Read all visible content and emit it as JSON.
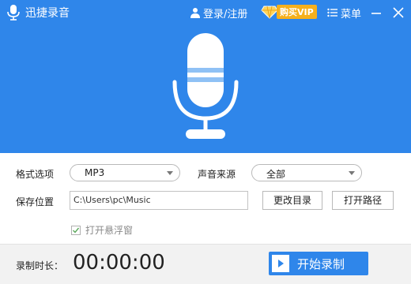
{
  "app": {
    "title": "迅捷录音"
  },
  "header": {
    "login_label": "登录/注册",
    "vip_label": "购买VIP",
    "menu_label": "菜单",
    "colors": {
      "background": "#2f86ea",
      "text": "#ffffff",
      "vip_badge": "#f6b01c"
    }
  },
  "icons": {
    "app_logo": "microphone-icon",
    "user": "user-icon",
    "vip": "diamond-icon",
    "menu": "menu-lines-icon",
    "minimize": "minimize-icon",
    "close": "close-icon",
    "hero": "microphone-icon",
    "start": "play-icon"
  },
  "form": {
    "format": {
      "label": "格式选项",
      "value": "MP3"
    },
    "source": {
      "label": "声音来源",
      "value": "全部"
    },
    "save": {
      "label": "保存位置",
      "value": "C:\\Users\\pc\\Music"
    },
    "change_dir_label": "更改目录",
    "open_path_label": "打开路径",
    "float_window": {
      "label": "打开悬浮窗",
      "checked": true
    }
  },
  "footer": {
    "duration_label": "录制时长：",
    "duration_value": "00:00:00",
    "start_label": "开始录制",
    "colors": {
      "start_button": "#2f86ea"
    }
  }
}
